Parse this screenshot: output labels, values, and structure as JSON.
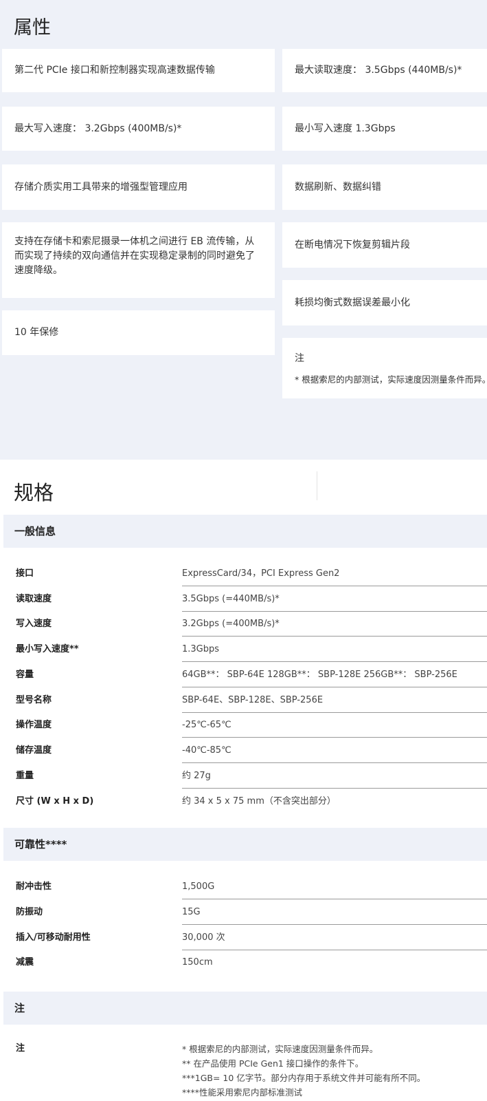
{
  "features": {
    "title": "属性",
    "cards": [
      "第二代 PCIe 接口和新控制器实现高速数据传输",
      "最大读取速度： 3.5Gbps (440MB/s)*",
      "最大写入速度： 3.2Gbps (400MB/s)*",
      "最小写入速度 1.3Gbps",
      "存储介质实用工具带来的增强型管理应用",
      "数据刷新、数据纠错",
      "支持在存储卡和索尼摄录一体机之间进行 EB 流传输，从而实现了持续的双向通信并在实现稳定录制的同时避免了速度降级。",
      "在断电情况下恢复剪辑片段",
      "耗损均衡式数据误差最小化",
      "10 年保修"
    ],
    "note_title": "注",
    "note_text": "* 根据索尼的内部测试，实际速度因测量条件而异。"
  },
  "specs": {
    "title": "规格",
    "general": {
      "title": "一般信息",
      "rows": [
        {
          "label": "接口",
          "value": "ExpressCard/34，PCI Express Gen2"
        },
        {
          "label": "读取速度",
          "value": "3.5Gbps (=440MB/s)*"
        },
        {
          "label": "写入速度",
          "value": "3.2Gbps (=400MB/s)*"
        },
        {
          "label": "最小写入速度**",
          "value": "1.3Gbps"
        },
        {
          "label": "容量",
          "value": "64GB**： SBP-64E 128GB**： SBP-128E 256GB**： SBP-256E"
        },
        {
          "label": "型号名称",
          "value": "SBP-64E、SBP-128E、SBP-256E"
        },
        {
          "label": "操作温度",
          "value": "-25℃-65℃"
        },
        {
          "label": "储存温度",
          "value": "-40℃-85℃"
        },
        {
          "label": "重量",
          "value": "约 27g"
        },
        {
          "label": "尺寸 (W x H x D)",
          "value": "约 34 x 5 x 75 mm（不含突出部分）"
        }
      ]
    },
    "reliability": {
      "title": "可靠性****",
      "rows": [
        {
          "label": "耐冲击性",
          "value": "1,500G"
        },
        {
          "label": "防振动",
          "value": "15G"
        },
        {
          "label": "插入/可移动耐用性",
          "value": "30,000 次"
        },
        {
          "label": "减震",
          "value": "150cm"
        }
      ]
    },
    "notes": {
      "title": "注",
      "label": "注",
      "lines": [
        "* 根据索尼的内部测试，实际速度因测量条件而异。",
        "** 在产品使用 PCIe Gen1 接口操作的条件下。",
        "***1GB= 10 亿字节。部分内存用于系统文件并可能有所不同。",
        "****性能采用索尼内部标准测试"
      ]
    }
  }
}
